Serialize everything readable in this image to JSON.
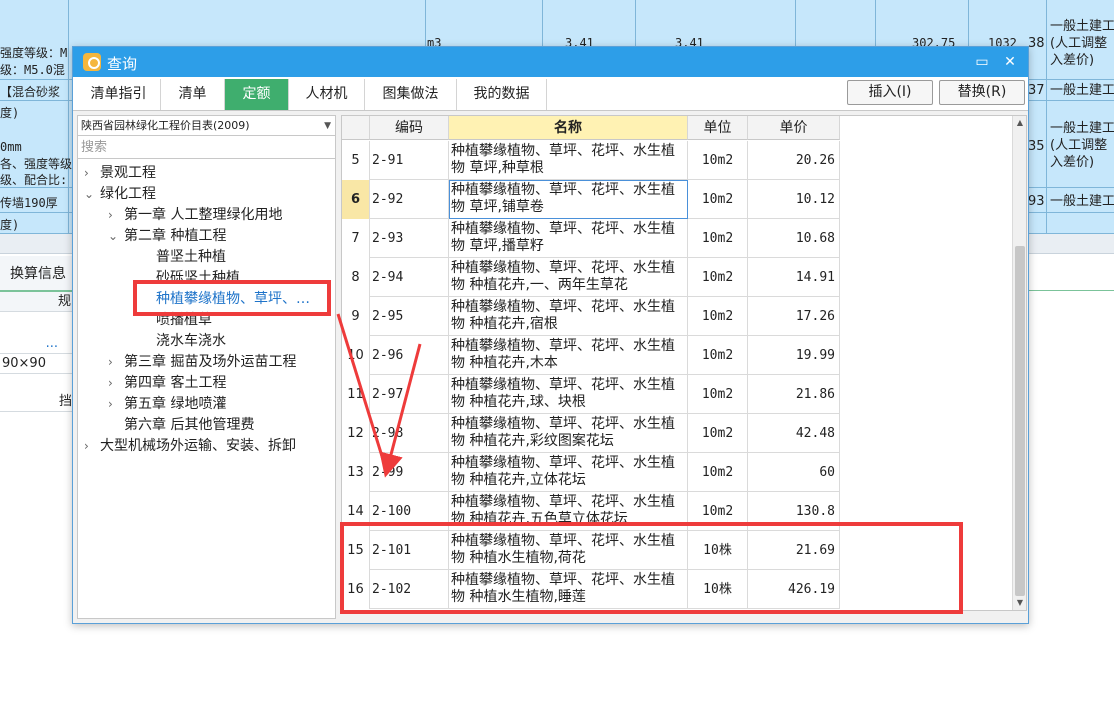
{
  "background": {
    "rows": [
      {
        "left_text": "强度等级：M",
        "left_text2": "级：M5.0混",
        "unit": "m3",
        "v1": "3.41",
        "v2": "3.41",
        "v3": "302.75",
        "v4": "1032",
        "rownum": "38",
        "right": [
          "一般土建工",
          "(人工调整",
          "入差价)"
        ]
      },
      {
        "left_text": "【混合砂浆",
        "rownum": "37",
        "right": [
          "一般土建工"
        ]
      },
      {
        "left_text": "度)",
        "left_text2": "0mm",
        "left_text3": "各、强度等级",
        "left_text4": "级、配合比:",
        "rownum": "35",
        "right": [
          "一般土建工",
          "(人工调整",
          "入差价)"
        ]
      },
      {
        "left_text": "传墙190厚",
        "rownum": "93",
        "right": [
          "一般土建工"
        ]
      },
      {
        "left_text": "度)"
      }
    ],
    "lower_tab": "换算信息",
    "lower_col": "规",
    "lower_grid": [
      "...",
      "90×90",
      "挡"
    ]
  },
  "dialog": {
    "title": "查询",
    "tabs": [
      "清单指引",
      "清单",
      "定额",
      "人材机",
      "图集做法",
      "我的数据"
    ],
    "active_tab": "定额",
    "insert_button": "插入(I)",
    "replace_button": "替换(R)"
  },
  "left": {
    "library": "陕西省园林绿化工程价目表(2009)",
    "search_placeholder": "搜索",
    "tree": [
      {
        "label": "景观工程",
        "chev": "›",
        "level": 0
      },
      {
        "label": "绿化工程",
        "chev": "⌄",
        "level": 0
      },
      {
        "label": "第一章  人工整理绿化用地",
        "chev": "›",
        "level": 1
      },
      {
        "label": "第二章  种植工程",
        "chev": "⌄",
        "level": 1
      },
      {
        "label": "普坚土种植",
        "chev": "",
        "level": 2
      },
      {
        "label": "砂砾坚土种植",
        "chev": "",
        "level": 2
      },
      {
        "label": "种植攀缘植物、草坪、…",
        "chev": "",
        "level": 2,
        "selected": true
      },
      {
        "label": "喷播植草",
        "chev": "",
        "level": 2
      },
      {
        "label": "浇水车浇水",
        "chev": "",
        "level": 2
      },
      {
        "label": "第三章  掘苗及场外运苗工程",
        "chev": "›",
        "level": 1
      },
      {
        "label": "第四章  客土工程",
        "chev": "›",
        "level": 1
      },
      {
        "label": "第五章  绿地喷灌",
        "chev": "›",
        "level": 1
      },
      {
        "label": "第六章  后其他管理费",
        "chev": "",
        "level": 1
      },
      {
        "label": "大型机械场外运输、安装、拆卸",
        "chev": "›",
        "level": 0
      }
    ]
  },
  "grid": {
    "headers": [
      "",
      "编码",
      "名称",
      "单位",
      "单价"
    ],
    "rows": [
      {
        "no": "5",
        "code": "2-91",
        "name": "种植攀缘植物、草坪、花坪、水生植物 草坪,种草根",
        "unit": "10m2",
        "price": "20.26"
      },
      {
        "no": "6",
        "code": "2-92",
        "name": "种植攀缘植物、草坪、花坪、水生植物 草坪,铺草卷",
        "unit": "10m2",
        "price": "10.12",
        "current": true
      },
      {
        "no": "7",
        "code": "2-93",
        "name": "种植攀缘植物、草坪、花坪、水生植物 草坪,播草籽",
        "unit": "10m2",
        "price": "10.68"
      },
      {
        "no": "8",
        "code": "2-94",
        "name": "种植攀缘植物、草坪、花坪、水生植物 种植花卉,一、两年生草花",
        "unit": "10m2",
        "price": "14.91"
      },
      {
        "no": "9",
        "code": "2-95",
        "name": "种植攀缘植物、草坪、花坪、水生植物 种植花卉,宿根",
        "unit": "10m2",
        "price": "17.26"
      },
      {
        "no": "10",
        "code": "2-96",
        "name": "种植攀缘植物、草坪、花坪、水生植物 种植花卉,木本",
        "unit": "10m2",
        "price": "19.99"
      },
      {
        "no": "11",
        "code": "2-97",
        "name": "种植攀缘植物、草坪、花坪、水生植物 种植花卉,球、块根",
        "unit": "10m2",
        "price": "21.86"
      },
      {
        "no": "12",
        "code": "2-98",
        "name": "种植攀缘植物、草坪、花坪、水生植物 种植花卉,彩纹图案花坛",
        "unit": "10m2",
        "price": "42.48"
      },
      {
        "no": "13",
        "code": "2-99",
        "name": "种植攀缘植物、草坪、花坪、水生植物 种植花卉,立体花坛",
        "unit": "10m2",
        "price": "60"
      },
      {
        "no": "14",
        "code": "2-100",
        "name": "种植攀缘植物、草坪、花坪、水生植物 种植花卉,五色草立体花坛",
        "unit": "10m2",
        "price": "130.8"
      },
      {
        "no": "15",
        "code": "2-101",
        "name": "种植攀缘植物、草坪、花坪、水生植物 种植水生植物,荷花",
        "unit": "10株",
        "price": "21.69"
      },
      {
        "no": "16",
        "code": "2-102",
        "name": "种植攀缘植物、草坪、花坪、水生植物 种植水生植物,睡莲",
        "unit": "10株",
        "price": "426.19"
      }
    ]
  },
  "colors": {
    "titlebar": "#2d9ee8",
    "active_tab": "#3fae6e",
    "annotation": "#ee3b3b",
    "header_highlight": "#fff2b3"
  }
}
